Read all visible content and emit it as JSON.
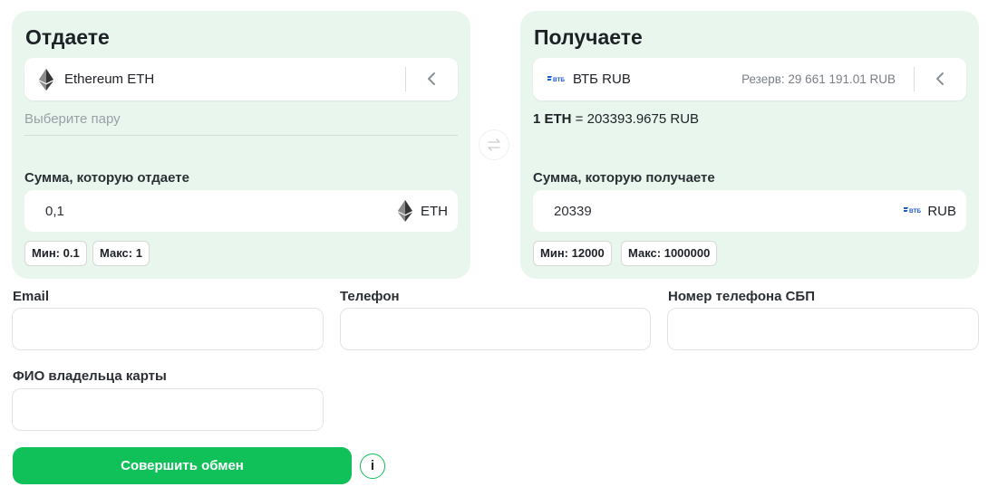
{
  "give": {
    "title": "Отдаете",
    "currency_name": "Ethereum ETH",
    "pair_hint": "Выберите пару",
    "sum_label": "Сумма, которую отдаете",
    "amount": "0,1",
    "amount_currency": "ETH",
    "min": "Мин: 0.1",
    "max": "Макс: 1",
    "icon": "ethereum-icon"
  },
  "get": {
    "title": "Получаете",
    "currency_name": "ВТБ RUB",
    "reserve": "Резерв: 29 661 191.01 RUB",
    "rate_left": "1 ETH",
    "rate_right": " = 203393.9675 RUB",
    "sum_label": "Сумма, которую получаете",
    "amount": "20339",
    "amount_currency": "RUB",
    "min": "Мин: 12000",
    "max": "Макс: 1000000",
    "icon": "vtb-logo-icon",
    "logo_text": "ВТБ"
  },
  "form": {
    "email_label": "Email",
    "phone_label": "Телефон",
    "sbp_label": "Номер телефона СБП",
    "fio_label": "ФИО владельца карты",
    "email_value": "",
    "phone_value": "",
    "sbp_value": "",
    "fio_value": ""
  },
  "actions": {
    "submit_label": "Совершить обмен",
    "info_label": "i"
  },
  "colors": {
    "accent": "#10c15a",
    "card_bg": "#e8f6ee",
    "vtb_blue": "#1a5bd6"
  }
}
